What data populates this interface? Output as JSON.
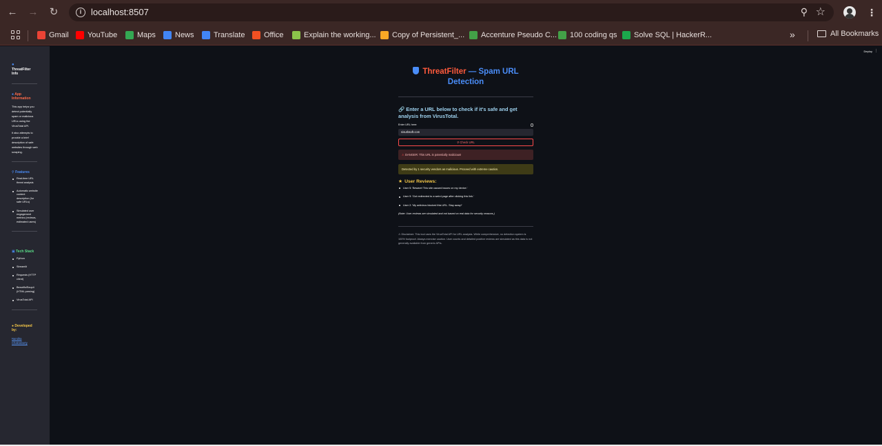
{
  "browser": {
    "url": "localhost:8507",
    "bookmarks": [
      {
        "label": "Gmail",
        "icon": "gmail-icon",
        "color": "#ea4335"
      },
      {
        "label": "YouTube",
        "icon": "youtube-icon",
        "color": "#ff0000"
      },
      {
        "label": "Maps",
        "icon": "maps-icon",
        "color": "#34a853"
      },
      {
        "label": "News",
        "icon": "news-icon",
        "color": "#4285f4"
      },
      {
        "label": "Translate",
        "icon": "translate-icon",
        "color": "#4285f4"
      },
      {
        "label": "Office",
        "icon": "office-icon",
        "color": "#f25022"
      },
      {
        "label": "Explain the working...",
        "icon": "s-icon",
        "color": "#8bc34a"
      },
      {
        "label": "Copy of Persistent_...",
        "icon": "infinity-icon",
        "color": "#f9a825"
      },
      {
        "label": "Accenture Pseudo C...",
        "icon": "p-icon",
        "color": "#43a047"
      },
      {
        "label": "100 coding qs",
        "icon": "p-icon",
        "color": "#43a047"
      },
      {
        "label": "Solve SQL | HackerR...",
        "icon": "hackerrank-icon",
        "color": "#1ba94c"
      }
    ],
    "all_bookmarks": "All Bookmarks"
  },
  "sidebar": {
    "title": "ThreatFilter Info",
    "app_info_head": "App Information",
    "app_info_p1": "This app helps you detect potentially spam or malicious URLs using the VirusTotal API.",
    "app_info_p2": "It also attempts to provide a brief description of safe websites through web scraping.",
    "features_head": "Features",
    "features": [
      "Real-time URL threat analysis",
      "Automatic website content description (for safe URLs)",
      "Simulated user engagement metrics (reviews, estimated users)"
    ],
    "tech_head": "Tech Stack",
    "tech": [
      "Python",
      "Streamlit",
      "Requests (HTTP client)",
      "BeautifulSoup4 (HTML parsing)",
      "VirusTotal API"
    ],
    "dev_head": "Developed by:",
    "dev_name": "Nandita Chakraborty"
  },
  "header": {
    "deploy": "Deploy"
  },
  "main": {
    "title_red": "ThreatFilter",
    "title_rest": " — Spam URL Detection",
    "subheader": "Enter a URL below to check if it's safe and get analysis from VirusTotal.",
    "input_label": "Enter URL here:",
    "input_value": "nisurbsoft.com",
    "check_button": "Check URL",
    "danger_msg": "DANGER: This URL is potentially malicious!",
    "warning_msg": "Detected by 1 security vendors as malicious. Proceed with extreme caution.",
    "reviews_head": "User Reviews:",
    "reviews": [
      "User 5: 'Beware! This site caused issues on my device.'",
      "User 9: 'Got redirected to a weird page after clicking this link.'",
      "User 2: 'My antivirus blocked this URL. Stay away!'"
    ],
    "reviews_note": "(Note: User reviews are simulated and not based on real data for security reasons.)",
    "disclaimer": "Disclaimer: This tool uses the VirusTotal API for URL analysis. While comprehensive, no detection system is 100% foolproof. Always exercise caution. User counts and detailed positive reviews are simulated as this data is not generally available from generic APIs."
  }
}
